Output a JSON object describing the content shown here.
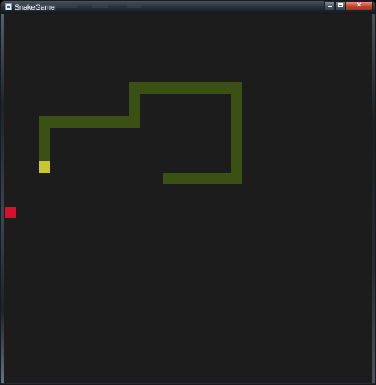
{
  "window": {
    "title": "SnakeGame",
    "icon": "app-window-icon",
    "controls": [
      "minimize-icon",
      "maximize-icon",
      "close-icon"
    ],
    "close_glyph": "✕"
  },
  "game": {
    "grid_cell_units": 14,
    "colors": {
      "background": "#1c1c1c",
      "snake_body": "#3b5114",
      "snake_head": "#c9c533",
      "food": "#d6102c"
    },
    "snake": {
      "head_cell": [
        3,
        13
      ],
      "body_path_cells": [
        [
          3,
          13
        ],
        [
          3,
          9
        ],
        [
          11,
          9
        ],
        [
          11,
          6
        ],
        [
          20,
          6
        ],
        [
          20,
          14
        ],
        [
          14,
          14
        ]
      ]
    },
    "food_cell": [
      0,
      17
    ]
  }
}
